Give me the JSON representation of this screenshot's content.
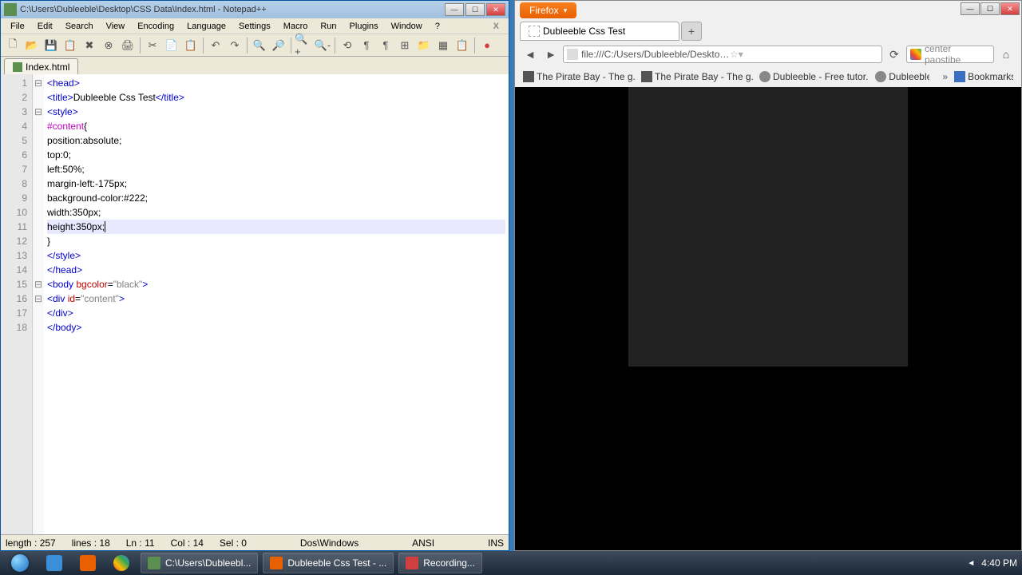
{
  "notepadpp": {
    "title": "C:\\Users\\Dubleeble\\Desktop\\CSS Data\\Index.html - Notepad++",
    "menu": [
      "File",
      "Edit",
      "Search",
      "View",
      "Encoding",
      "Language",
      "Settings",
      "Macro",
      "Run",
      "Plugins",
      "Window",
      "?"
    ],
    "tab_name": "Index.html",
    "status": {
      "length": "length : 257",
      "lines": "lines : 18",
      "ln": "Ln : 11",
      "col": "Col : 14",
      "sel": "Sel : 0",
      "eol": "Dos\\Windows",
      "encoding": "ANSI",
      "mode": "INS"
    },
    "code_lines": [
      {
        "n": 1,
        "fold": "⊟",
        "html": "<span class='tag'>&lt;head&gt;</span>"
      },
      {
        "n": 2,
        "fold": "",
        "html": "<span class='tag'>&lt;title&gt;</span>Dubleeble Css Test<span class='tag'>&lt;/title&gt;</span>"
      },
      {
        "n": 3,
        "fold": "⊟",
        "html": "<span class='tag'>&lt;style&gt;</span>"
      },
      {
        "n": 4,
        "fold": "",
        "html": "<span class='sel'>#content</span>{"
      },
      {
        "n": 5,
        "fold": "",
        "html": "position:absolute;"
      },
      {
        "n": 6,
        "fold": "",
        "html": "top:0;"
      },
      {
        "n": 7,
        "fold": "",
        "html": "left:50%;"
      },
      {
        "n": 8,
        "fold": "",
        "html": "margin-left:-175px;"
      },
      {
        "n": 9,
        "fold": "",
        "html": "background-color:#222;"
      },
      {
        "n": 10,
        "fold": "",
        "html": "width:350px;"
      },
      {
        "n": 11,
        "fold": "",
        "html": "height:350px;<span class='caret'></span>",
        "hl": true
      },
      {
        "n": 12,
        "fold": "",
        "html": "}"
      },
      {
        "n": 13,
        "fold": "",
        "html": "<span class='tag'>&lt;/style&gt;</span>"
      },
      {
        "n": 14,
        "fold": "",
        "html": "<span class='tag'>&lt;/head&gt;</span>"
      },
      {
        "n": 15,
        "fold": "⊟",
        "html": "<span class='tag'>&lt;body</span> <span class='attr'>bgcolor</span>=<span class='str'>\"black\"</span><span class='tag'>&gt;</span>"
      },
      {
        "n": 16,
        "fold": "⊟",
        "html": "<span class='tag'>&lt;div</span> <span class='attr'>id</span>=<span class='str'>\"content\"</span><span class='tag'>&gt;</span>"
      },
      {
        "n": 17,
        "fold": "",
        "html": "<span class='tag'>&lt;/div&gt;</span>"
      },
      {
        "n": 18,
        "fold": "",
        "html": "<span class='tag'>&lt;/body&gt;</span>"
      }
    ]
  },
  "firefox": {
    "button_label": "Firefox",
    "tab_title": "Dubleeble Css Test",
    "url": "file:///C:/Users/Dubleeble/Desktop/CSS Data/Index.html",
    "search_value": "center paostibe",
    "bookmarks": [
      "The Pirate Bay - The g...",
      "The Pirate Bay - The g...",
      "Dubleeble - Free tutor...",
      "Dubleeble"
    ],
    "bookmarks_label": "Bookmarks"
  },
  "taskbar": {
    "items": [
      {
        "label": "C:\\Users\\Dubleebl...",
        "color": "#5a8f4f"
      },
      {
        "label": "Dubleeble Css Test - ...",
        "color": "#e86000"
      },
      {
        "label": "Recording...",
        "color": "#d04040"
      }
    ],
    "time": "4:40 PM"
  }
}
